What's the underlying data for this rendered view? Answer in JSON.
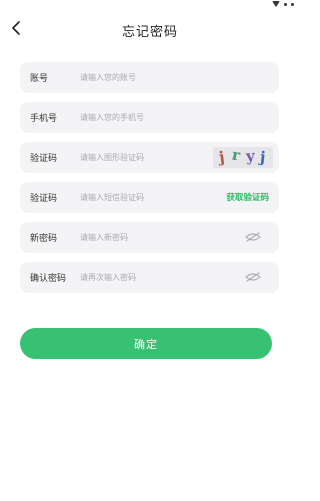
{
  "header": {
    "title": "忘记密码"
  },
  "form": {
    "account": {
      "label": "账号",
      "placeholder": "请输入您的账号"
    },
    "phone": {
      "label": "手机号",
      "placeholder": "请输入您的手机号"
    },
    "image_code": {
      "label": "验证码",
      "placeholder": "请输入图形验证码",
      "captcha_chars": [
        "j",
        "r",
        "y",
        "j"
      ]
    },
    "sms_code": {
      "label": "验证码",
      "placeholder": "请输入短信验证码",
      "send_label": "获取验证码"
    },
    "new_password": {
      "label": "新密码",
      "placeholder": "请输入新密码"
    },
    "confirm_password": {
      "label": "确认密码",
      "placeholder": "请再次输入密码"
    }
  },
  "confirm_button": {
    "label": "确定"
  },
  "colors": {
    "accent": "#38c173",
    "sms_link": "#2fb864",
    "field_bg": "#f4f4f6"
  }
}
